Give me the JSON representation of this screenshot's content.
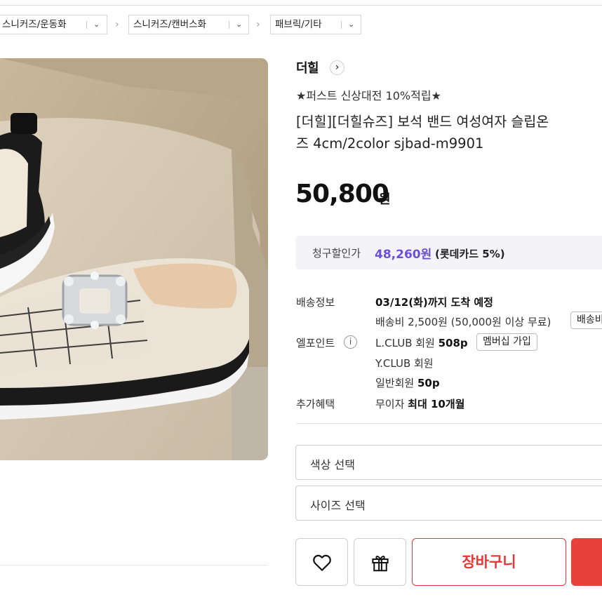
{
  "breadcrumbs": [
    {
      "label": "스니커즈/운동화"
    },
    {
      "label": "스니커즈/캔버스화"
    },
    {
      "label": "패브릭/기타"
    }
  ],
  "product": {
    "brand": "더힐",
    "promo": "★퍼스트 신상대전 10%적립★",
    "title_line1": "[더힐][더힐슈즈] 보석 밴드 여성여자 슬립온",
    "title_line2": "즈 4cm/2color sjbad-m9901",
    "price": "50,800",
    "price_unit": "원"
  },
  "discount": {
    "label": "청구할인가",
    "amount": "48,260원",
    "card": "(롯데카드 5%)"
  },
  "shipping": {
    "label": "배송정보",
    "arrival": "03/12(화)까지 도착 예정",
    "fee": "배송비 2,500원 (50,000원 이상 무료)",
    "fee_button": "배송비"
  },
  "points": {
    "label": "엘포인트",
    "lclub": "L.CLUB 회원 ",
    "lclub_points": "508p",
    "join_button": "멤버십 가입",
    "yclub": "Y.CLUB 회원",
    "general": "일반회원 ",
    "general_points": "50p"
  },
  "benefit": {
    "label": "추가혜택",
    "text": "무이자 ",
    "bold": "최대 10개월"
  },
  "options": {
    "color_placeholder": "색상 선택",
    "size_placeholder": "사이즈 선택"
  },
  "actions": {
    "cart": "장바구니"
  },
  "colors": {
    "accent_purple": "#6a4fd8",
    "cart_red": "#e63737",
    "buy_red": "#e8413a"
  }
}
